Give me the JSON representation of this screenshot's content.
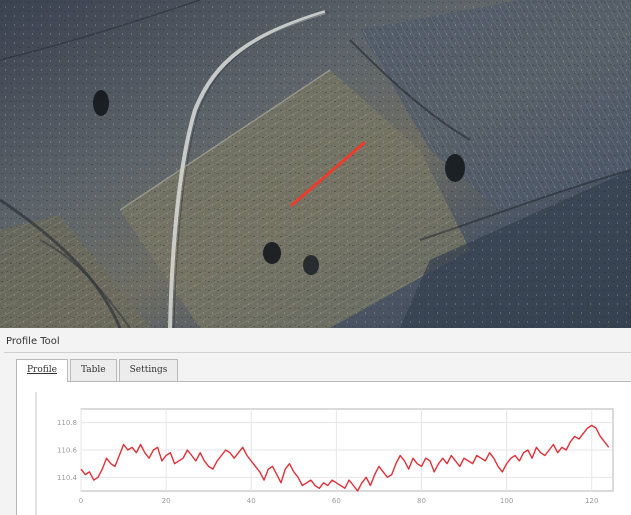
{
  "panel": {
    "title": "Profile Tool",
    "tabs": [
      {
        "label": "Profile",
        "active": true
      },
      {
        "label": "Table",
        "active": false
      },
      {
        "label": "Settings",
        "active": false
      }
    ]
  },
  "map": {
    "profile_line_color": "#ee3b2c"
  },
  "chart_data": {
    "type": "line",
    "title": "",
    "xlabel": "",
    "ylabel": "",
    "xlim": [
      0,
      125
    ],
    "ylim": [
      111.5,
      114.5
    ],
    "x_ticks": [
      0,
      20,
      40,
      60,
      80,
      100,
      120
    ],
    "y_ticks": [
      {
        "value": 112.0,
        "label": "110.4"
      },
      {
        "value": 113.0,
        "label": "110.6"
      },
      {
        "value": 114.0,
        "label": "110.8"
      }
    ],
    "grid": true,
    "series": [
      {
        "color": "#e0303a",
        "x": [
          0,
          1,
          2,
          3,
          4,
          5,
          6,
          7,
          8,
          9,
          10,
          11,
          12,
          13,
          14,
          15,
          16,
          17,
          18,
          19,
          20,
          21,
          22,
          23,
          24,
          25,
          26,
          27,
          28,
          29,
          30,
          31,
          32,
          33,
          34,
          35,
          36,
          37,
          38,
          39,
          40,
          41,
          42,
          43,
          44,
          45,
          46,
          47,
          48,
          49,
          50,
          51,
          52,
          53,
          54,
          55,
          56,
          57,
          58,
          59,
          60,
          61,
          62,
          63,
          64,
          65,
          66,
          67,
          68,
          69,
          70,
          71,
          72,
          73,
          74,
          75,
          76,
          77,
          78,
          79,
          80,
          81,
          82,
          83,
          84,
          85,
          86,
          87,
          88,
          89,
          90,
          91,
          92,
          93,
          94,
          95,
          96,
          97,
          98,
          99,
          100,
          101,
          102,
          103,
          104,
          105,
          106,
          107,
          108,
          109,
          110,
          111,
          112,
          113,
          114,
          115,
          116,
          117,
          118,
          119,
          120,
          121,
          122,
          123,
          124
        ],
        "values": [
          112.3,
          112.1,
          112.2,
          111.9,
          112.0,
          112.3,
          112.7,
          112.5,
          112.4,
          112.8,
          113.2,
          113.0,
          113.1,
          112.9,
          113.2,
          112.9,
          112.7,
          113.0,
          113.1,
          112.6,
          112.8,
          112.9,
          112.5,
          112.6,
          112.7,
          113.0,
          112.8,
          112.6,
          112.9,
          112.6,
          112.4,
          112.3,
          112.6,
          112.8,
          113.0,
          112.9,
          112.7,
          112.9,
          113.1,
          112.8,
          112.6,
          112.4,
          112.2,
          111.9,
          112.3,
          112.4,
          112.1,
          111.8,
          112.3,
          112.5,
          112.2,
          112.0,
          111.7,
          111.8,
          111.9,
          111.7,
          111.6,
          111.8,
          111.7,
          111.9,
          111.8,
          111.7,
          111.6,
          111.9,
          111.7,
          111.5,
          111.8,
          112.0,
          111.7,
          112.1,
          112.4,
          112.2,
          112.0,
          112.1,
          112.5,
          112.8,
          112.6,
          112.3,
          112.7,
          112.5,
          112.4,
          112.7,
          112.6,
          112.2,
          112.5,
          112.7,
          112.5,
          112.8,
          112.6,
          112.4,
          112.7,
          112.6,
          112.5,
          112.8,
          112.7,
          112.6,
          112.9,
          112.7,
          112.4,
          112.2,
          112.5,
          112.7,
          112.8,
          112.6,
          112.9,
          113.0,
          112.7,
          113.1,
          112.9,
          112.8,
          113.0,
          113.2,
          112.9,
          113.1,
          113.0,
          113.3,
          113.5,
          113.4,
          113.6,
          113.8,
          113.9,
          113.8,
          113.5,
          113.3,
          113.1
        ]
      }
    ]
  }
}
